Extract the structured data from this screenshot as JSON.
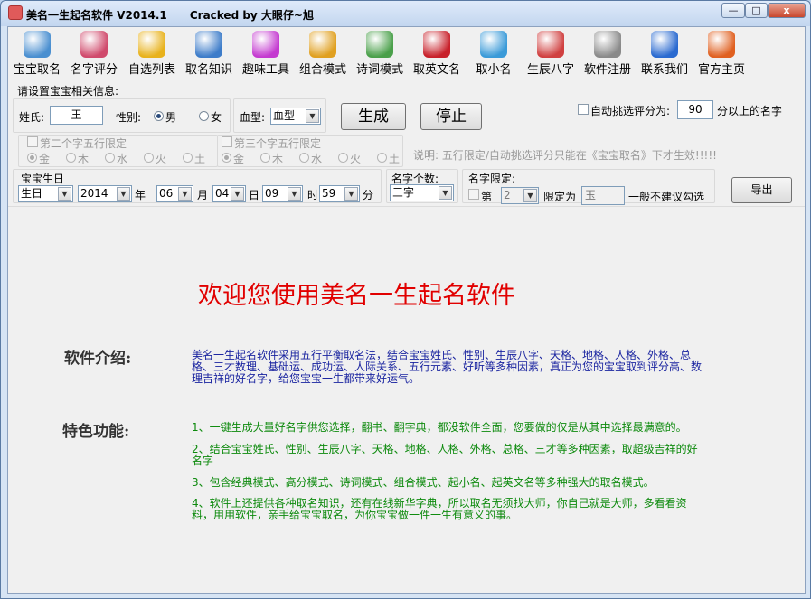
{
  "window": {
    "title": "美名一生起名软件 V2014.1      Cracked by 大眼仔~旭",
    "min": "—",
    "max": "□",
    "close": "x"
  },
  "toolbar": [
    {
      "label": "宝宝取名",
      "icon": "baby-icon",
      "color": "#4a8fd0"
    },
    {
      "label": "名字评分",
      "icon": "badge-icon",
      "color": "#d04a6c"
    },
    {
      "label": "自选列表",
      "icon": "star-icon",
      "color": "#e8b21c"
    },
    {
      "label": "取名知识",
      "icon": "notebook-icon",
      "color": "#3d7cc9"
    },
    {
      "label": "趣味工具",
      "icon": "gear-icon",
      "color": "#c43ad0"
    },
    {
      "label": "组合模式",
      "icon": "magnifier-icon",
      "color": "#e0a020"
    },
    {
      "label": "诗词模式",
      "icon": "book-icon",
      "color": "#4aa04a"
    },
    {
      "label": "取英文名",
      "icon": "flag-icon",
      "color": "#c8202a"
    },
    {
      "label": "取小名",
      "icon": "puzzle-icon",
      "color": "#3a9ad8"
    },
    {
      "label": "生辰八字",
      "icon": "calendar-icon",
      "color": "#d04040"
    },
    {
      "label": "软件注册",
      "icon": "key-icon",
      "color": "#8a8a8a"
    },
    {
      "label": "联系我们",
      "icon": "globe-icon",
      "color": "#2a6ad0"
    },
    {
      "label": "官方主页",
      "icon": "home-icon",
      "color": "#e06020"
    }
  ],
  "form": {
    "section_label": "请设置宝宝相关信息:",
    "surname_label": "姓氏:",
    "surname_value": "王",
    "gender_label": "性别:",
    "male": "男",
    "female": "女",
    "blood_label": "血型:",
    "blood_value": "血型",
    "generate": "生成",
    "stop": "停止",
    "auto_pick_label": "自动挑选评分为:",
    "auto_pick_value": "90",
    "auto_pick_suffix": "分以上的名字",
    "second_char": "第二个字五行限定",
    "third_char": "第三个字五行限定",
    "elements": [
      "金",
      "木",
      "水",
      "火",
      "土"
    ],
    "note": "说明: 五行限定/自动挑选评分只能在《宝宝取名》下才生效!!!!!",
    "birthday_label": "宝宝生日",
    "calendar_value": "生日",
    "year": "2014",
    "year_unit": "年",
    "month": "06",
    "month_unit": "月",
    "day": "04",
    "day_unit": "日",
    "hour": "09",
    "hour_unit": "时",
    "minute": "59",
    "minute_unit": "分",
    "name_count_label": "名字个数:",
    "name_count_value": "三字",
    "name_limit_label": "名字限定:",
    "limit_first": "第",
    "limit_pos": "2",
    "limit_as": "限定为",
    "limit_char": "玉",
    "limit_hint": "一般不建议勾选",
    "export": "导出"
  },
  "main": {
    "welcome": "欢迎您使用美名一生起名软件",
    "intro_heading": "软件介绍:",
    "intro_text": "美名一生起名软件采用五行平衡取名法，结合宝宝姓氏、性别、生辰八字、天格、地格、人格、外格、总格、三才数理、基础运、成功运、人际关系、五行元素、好听等多种因素，真正为您的宝宝取到评分高、数理吉祥的好名字，给您宝宝一生都带来好运气。",
    "features_heading": "特色功能:",
    "features": [
      "1、一键生成大量好名字供您选择，翻书、翻字典，都没软件全面，您要做的仅是从其中选择最满意的。",
      "2、结合宝宝姓氏、性别、生辰八字、天格、地格、人格、外格、总格、三才等多种因素，取超级吉祥的好名字",
      "3、包含经典模式、高分模式、诗词模式、组合模式、起小名、起英文名等多种强大的取名模式。",
      "4、软件上还提供各种取名知识，还有在线新华字典，所以取名无须找大师，你自己就是大师，多看看资料，用用软件，亲手给宝宝取名，为你宝宝做一件一生有意义的事。"
    ]
  }
}
